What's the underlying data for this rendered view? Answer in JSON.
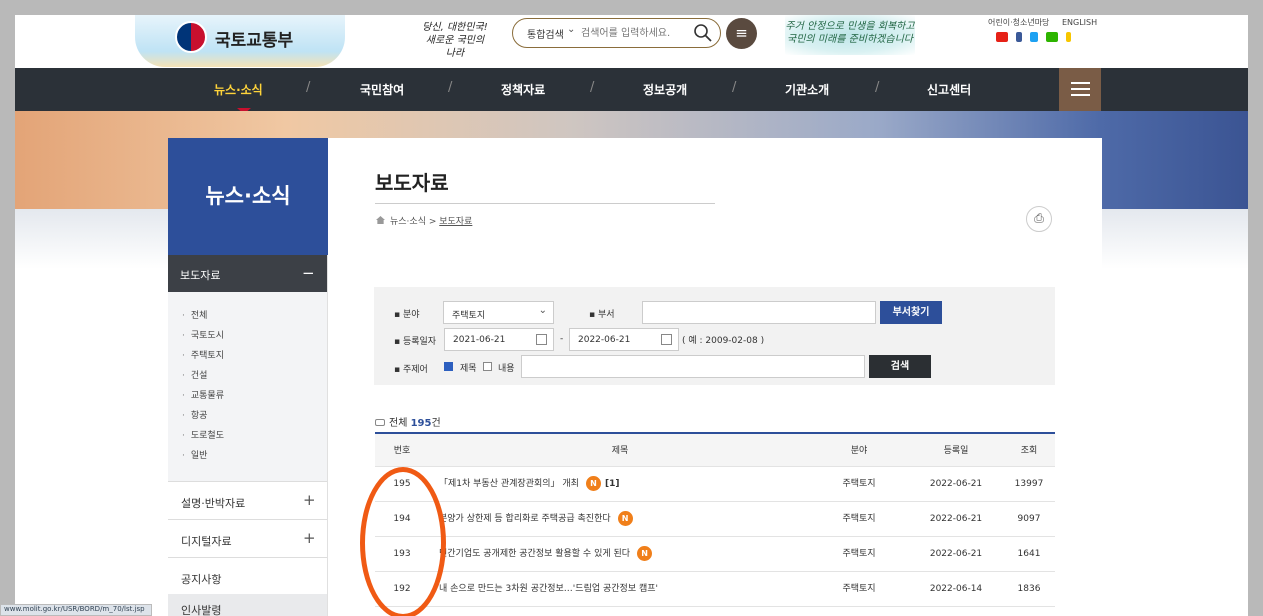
{
  "header": {
    "logo_text": "국토교통부",
    "slogan": "당신, 대한민국! 새로운 국민의 나라",
    "search": {
      "category": "통합검색",
      "placeholder": "검색어를 입력하세요."
    },
    "banner_text": "주거 안정으로 민생을 회복하고 국민의 미래를 준비하겠습니다",
    "util_links": [
      "어린이·청소년마당",
      "ENGLISH"
    ]
  },
  "nav": {
    "items": [
      "뉴스·소식",
      "국민참여",
      "정책자료",
      "정보공개",
      "기관소개",
      "신고센터"
    ],
    "active": "뉴스·소식"
  },
  "sidebar": {
    "title": "뉴스·소식",
    "active_section": "보도자료",
    "sub_items": [
      "전체",
      "국토도시",
      "주택토지",
      "건설",
      "교통물류",
      "항공",
      "도로철도",
      "일반"
    ],
    "categories": [
      "설명·반박자료",
      "디지털자료",
      "공지사항"
    ],
    "partial_category": "인사발령"
  },
  "content": {
    "page_title": "보도자료",
    "breadcrumb": [
      "뉴스·소식",
      "보도자료"
    ],
    "filter": {
      "field_label": "분야",
      "field_value": "주택토지",
      "dept_label": "부서",
      "dept_value": "",
      "dept_button": "부서찾기",
      "date_label": "등록일자",
      "date_from": "2021-06-21",
      "date_sep": "-",
      "date_to": "2022-06-21",
      "date_hint": "( 예 : 2009-02-08 )",
      "topic_label": "주제어",
      "check_title": "제목",
      "check_body": "내용",
      "search_button": "검색"
    },
    "total_prefix": "전체",
    "total_count": "195",
    "total_suffix": "건",
    "table": {
      "headers": [
        "번호",
        "제목",
        "분야",
        "등록일",
        "조회"
      ],
      "rows": [
        {
          "no": "195",
          "title": "「제1차 부동산 관계장관회의」 개최",
          "badge": "N",
          "extra": "[1]",
          "field": "주택토지",
          "date": "2022-06-21",
          "views": "13997"
        },
        {
          "no": "194",
          "title": "분양가 상한제 등 합리화로 주택공급 촉진한다",
          "badge": "N",
          "extra": "",
          "field": "주택토지",
          "date": "2022-06-21",
          "views": "9097"
        },
        {
          "no": "193",
          "title": "민간기업도 공개제한 공간정보 활용할 수 있게 된다",
          "badge": "N",
          "extra": "",
          "field": "주택토지",
          "date": "2022-06-21",
          "views": "1641"
        },
        {
          "no": "192",
          "title": "내 손으로 만드는 3차원 공간정보…'드림업 공간정보 캠프'",
          "badge": "",
          "extra": "",
          "field": "주택토지",
          "date": "2022-06-14",
          "views": "1836"
        }
      ]
    }
  },
  "status_bar_url": "www.molit.go.kr/USR/BORD/m_70/lst.jsp",
  "colors": {
    "nav_bg": "#2b3138",
    "brand_blue": "#2d4f9a",
    "badge_orange": "#f07f1a",
    "annotation": "#f05a14",
    "active_nav": "#ffd43a"
  }
}
